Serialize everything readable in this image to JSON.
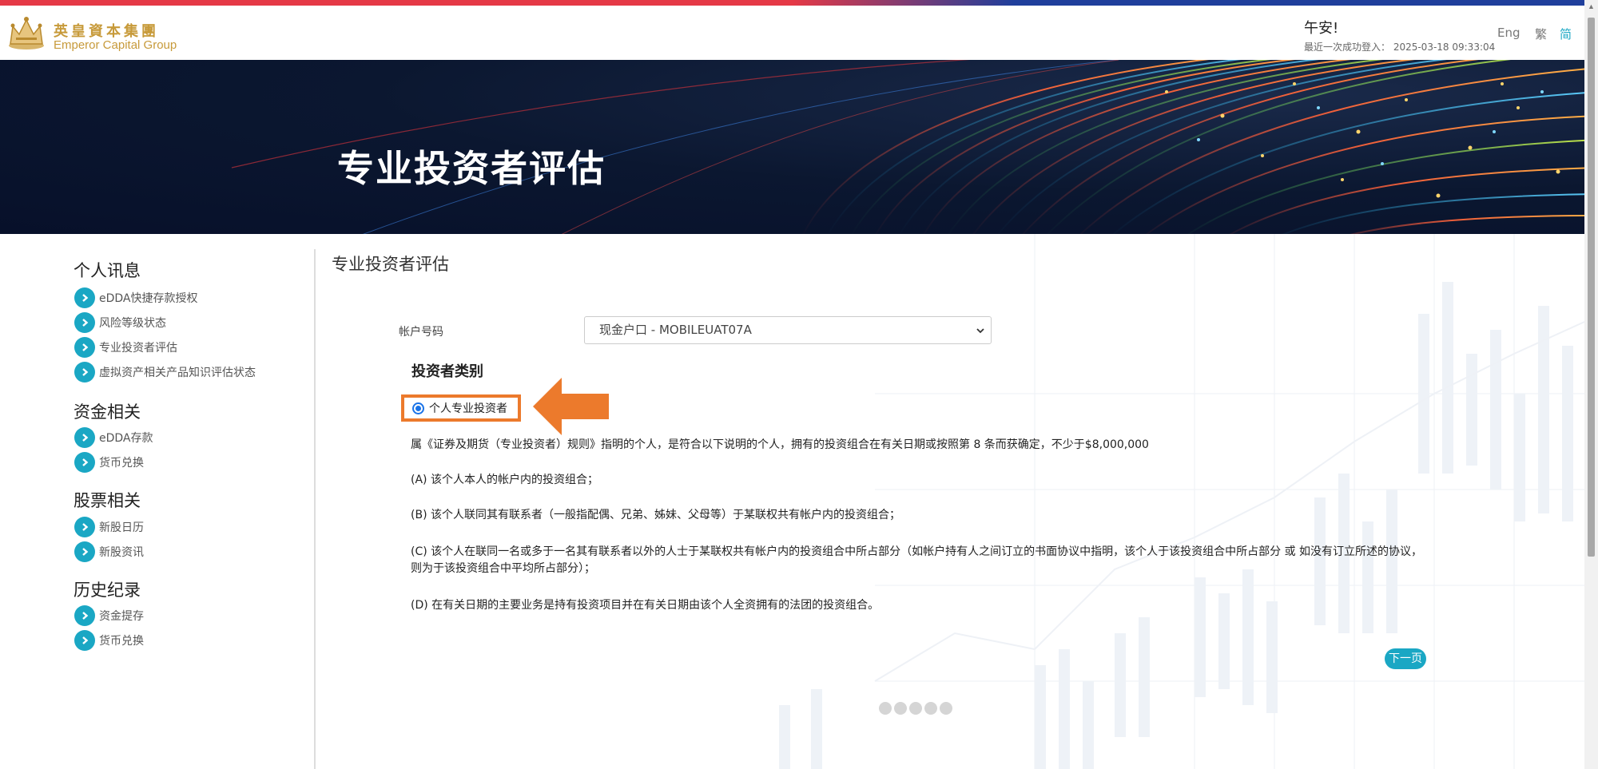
{
  "header": {
    "brand_cn": "英皇資本集團",
    "brand_en": "Emperor Capital Group",
    "greeting": "午安!",
    "last_login": "最近一次成功登入： 2025-03-18 09:33:04",
    "languages": [
      "Eng",
      "繁",
      "简"
    ],
    "active_language": "简"
  },
  "banner": {
    "title": "专业投资者评估"
  },
  "sidebar": {
    "sections": [
      {
        "heading": "个人讯息",
        "items": [
          "eDDA快捷存款授权",
          "风险等级状态",
          "专业投资者评估",
          "虚拟资产相关产品知识评估状态"
        ]
      },
      {
        "heading": "资金相关",
        "items": [
          "eDDA存款",
          "货币兑换"
        ]
      },
      {
        "heading": "股票相关",
        "items": [
          "新股日历",
          "新股资讯"
        ]
      },
      {
        "heading": "历史纪录",
        "items": [
          "资金提存",
          "货币兑换"
        ]
      }
    ]
  },
  "main": {
    "section_title": "专业投资者评估",
    "account_label": "帐户号码",
    "account_value": "现金户口 - MOBILEUAT07A",
    "investor_type_heading": "投资者类别",
    "radio_label": "个人专业投资者",
    "radio_selected": true,
    "paragraphs": [
      "属《证券及期货（专业投资者）规则》指明的个人，是符合以下说明的个人，拥有的投资组合在有关日期或按照第 8 条而获确定，不少于$8,000,000",
      "(A) 该个人本人的帐户内的投资组合；",
      "(B) 该个人联同其有联系者（一般指配偶、兄弟、姊妹、父母等）于某联权共有帐户内的投资组合；",
      "(C) 该个人在联同一名或多于一名其有联系者以外的人士于某联权共有帐户内的投资组合中所占部分（如帐户持有人之间订立的书面协议中指明，该个人于该投资组合中所占部分 或 如没有订立所述的协议，则为于该投资组合中平均所占部分）；",
      "(D) 在有关日期的主要业务是持有投资项目并在有关日期由该个人全资拥有的法团的投资组合。"
    ],
    "next_button": "下一页",
    "pager_dots": 5
  },
  "colors": {
    "accent": "#1aa7c4",
    "highlight": "#ec7a2c",
    "brand_gold": "#c79a3a"
  }
}
